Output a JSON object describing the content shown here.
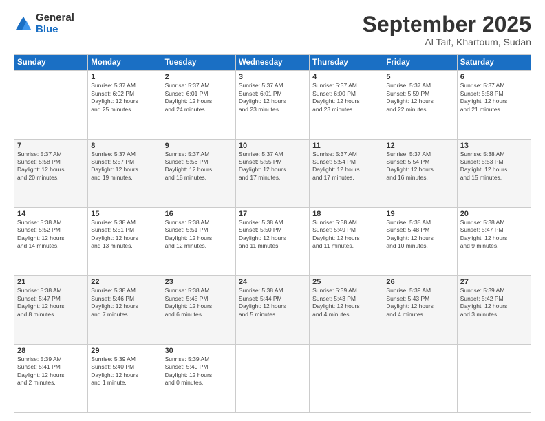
{
  "logo": {
    "general": "General",
    "blue": "Blue"
  },
  "header": {
    "month": "September 2025",
    "location": "Al Taif, Khartoum, Sudan"
  },
  "weekdays": [
    "Sunday",
    "Monday",
    "Tuesday",
    "Wednesday",
    "Thursday",
    "Friday",
    "Saturday"
  ],
  "weeks": [
    [
      {
        "day": "",
        "info": ""
      },
      {
        "day": "1",
        "info": "Sunrise: 5:37 AM\nSunset: 6:02 PM\nDaylight: 12 hours\nand 25 minutes."
      },
      {
        "day": "2",
        "info": "Sunrise: 5:37 AM\nSunset: 6:01 PM\nDaylight: 12 hours\nand 24 minutes."
      },
      {
        "day": "3",
        "info": "Sunrise: 5:37 AM\nSunset: 6:01 PM\nDaylight: 12 hours\nand 23 minutes."
      },
      {
        "day": "4",
        "info": "Sunrise: 5:37 AM\nSunset: 6:00 PM\nDaylight: 12 hours\nand 23 minutes."
      },
      {
        "day": "5",
        "info": "Sunrise: 5:37 AM\nSunset: 5:59 PM\nDaylight: 12 hours\nand 22 minutes."
      },
      {
        "day": "6",
        "info": "Sunrise: 5:37 AM\nSunset: 5:58 PM\nDaylight: 12 hours\nand 21 minutes."
      }
    ],
    [
      {
        "day": "7",
        "info": "Sunrise: 5:37 AM\nSunset: 5:58 PM\nDaylight: 12 hours\nand 20 minutes."
      },
      {
        "day": "8",
        "info": "Sunrise: 5:37 AM\nSunset: 5:57 PM\nDaylight: 12 hours\nand 19 minutes."
      },
      {
        "day": "9",
        "info": "Sunrise: 5:37 AM\nSunset: 5:56 PM\nDaylight: 12 hours\nand 18 minutes."
      },
      {
        "day": "10",
        "info": "Sunrise: 5:37 AM\nSunset: 5:55 PM\nDaylight: 12 hours\nand 17 minutes."
      },
      {
        "day": "11",
        "info": "Sunrise: 5:37 AM\nSunset: 5:54 PM\nDaylight: 12 hours\nand 17 minutes."
      },
      {
        "day": "12",
        "info": "Sunrise: 5:37 AM\nSunset: 5:54 PM\nDaylight: 12 hours\nand 16 minutes."
      },
      {
        "day": "13",
        "info": "Sunrise: 5:38 AM\nSunset: 5:53 PM\nDaylight: 12 hours\nand 15 minutes."
      }
    ],
    [
      {
        "day": "14",
        "info": "Sunrise: 5:38 AM\nSunset: 5:52 PM\nDaylight: 12 hours\nand 14 minutes."
      },
      {
        "day": "15",
        "info": "Sunrise: 5:38 AM\nSunset: 5:51 PM\nDaylight: 12 hours\nand 13 minutes."
      },
      {
        "day": "16",
        "info": "Sunrise: 5:38 AM\nSunset: 5:51 PM\nDaylight: 12 hours\nand 12 minutes."
      },
      {
        "day": "17",
        "info": "Sunrise: 5:38 AM\nSunset: 5:50 PM\nDaylight: 12 hours\nand 11 minutes."
      },
      {
        "day": "18",
        "info": "Sunrise: 5:38 AM\nSunset: 5:49 PM\nDaylight: 12 hours\nand 11 minutes."
      },
      {
        "day": "19",
        "info": "Sunrise: 5:38 AM\nSunset: 5:48 PM\nDaylight: 12 hours\nand 10 minutes."
      },
      {
        "day": "20",
        "info": "Sunrise: 5:38 AM\nSunset: 5:47 PM\nDaylight: 12 hours\nand 9 minutes."
      }
    ],
    [
      {
        "day": "21",
        "info": "Sunrise: 5:38 AM\nSunset: 5:47 PM\nDaylight: 12 hours\nand 8 minutes."
      },
      {
        "day": "22",
        "info": "Sunrise: 5:38 AM\nSunset: 5:46 PM\nDaylight: 12 hours\nand 7 minutes."
      },
      {
        "day": "23",
        "info": "Sunrise: 5:38 AM\nSunset: 5:45 PM\nDaylight: 12 hours\nand 6 minutes."
      },
      {
        "day": "24",
        "info": "Sunrise: 5:38 AM\nSunset: 5:44 PM\nDaylight: 12 hours\nand 5 minutes."
      },
      {
        "day": "25",
        "info": "Sunrise: 5:39 AM\nSunset: 5:43 PM\nDaylight: 12 hours\nand 4 minutes."
      },
      {
        "day": "26",
        "info": "Sunrise: 5:39 AM\nSunset: 5:43 PM\nDaylight: 12 hours\nand 4 minutes."
      },
      {
        "day": "27",
        "info": "Sunrise: 5:39 AM\nSunset: 5:42 PM\nDaylight: 12 hours\nand 3 minutes."
      }
    ],
    [
      {
        "day": "28",
        "info": "Sunrise: 5:39 AM\nSunset: 5:41 PM\nDaylight: 12 hours\nand 2 minutes."
      },
      {
        "day": "29",
        "info": "Sunrise: 5:39 AM\nSunset: 5:40 PM\nDaylight: 12 hours\nand 1 minute."
      },
      {
        "day": "30",
        "info": "Sunrise: 5:39 AM\nSunset: 5:40 PM\nDaylight: 12 hours\nand 0 minutes."
      },
      {
        "day": "",
        "info": ""
      },
      {
        "day": "",
        "info": ""
      },
      {
        "day": "",
        "info": ""
      },
      {
        "day": "",
        "info": ""
      }
    ]
  ]
}
